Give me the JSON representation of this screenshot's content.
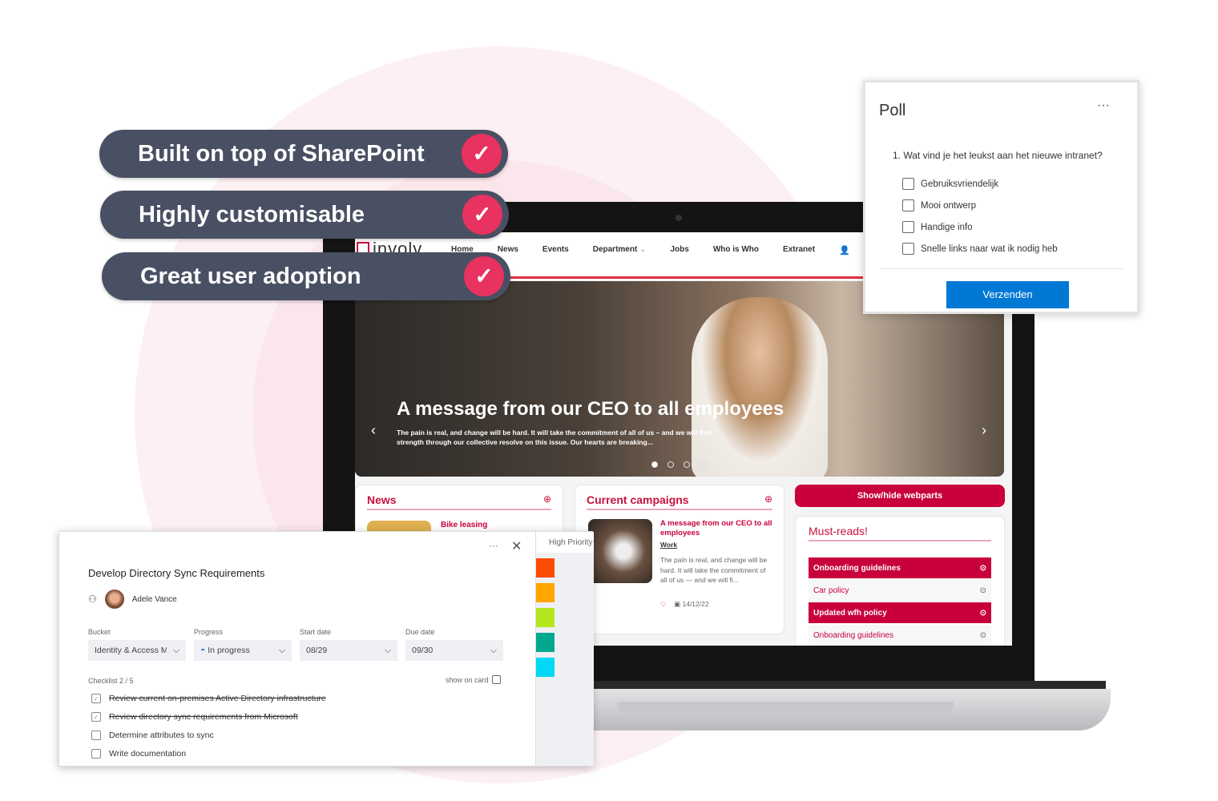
{
  "pills": [
    {
      "label": "Built on top of SharePoint"
    },
    {
      "label": "Highly customisable"
    },
    {
      "label": "Great user adoption"
    }
  ],
  "intranet": {
    "logo": "involv",
    "nav": [
      "Home",
      "News",
      "Events",
      "Department",
      "Jobs",
      "Who is Who",
      "Extranet"
    ],
    "hero": {
      "title": "A message from our CEO to all employees",
      "text": "The pain is real, and change will be hard. It will take the commitment of all of us – and we will find strength through our collective resolve on this issue.  Our hearts are breaking..."
    },
    "news": {
      "title": "News",
      "item": "Bike leasing"
    },
    "campaigns": {
      "title": "Current campaigns",
      "item_title": "A message from our CEO to all employees",
      "tag": "Work",
      "text": "The pain is real, and change will be hard. It will take the commitment of all of us — and we will fi...",
      "date": "14/12/22"
    },
    "show_hide": "Show/hide webparts",
    "must_reads": {
      "title": "Must-reads!",
      "items": [
        {
          "label": "Onboarding guidelines",
          "highlight": true
        },
        {
          "label": "Car policy",
          "highlight": false
        },
        {
          "label": "Updated wfh policy",
          "highlight": true
        },
        {
          "label": "Onboarding guidelines",
          "highlight": false
        }
      ]
    },
    "accent": "#c8003c"
  },
  "poll": {
    "title": "Poll",
    "question": "1. Wat vind je het leukst aan het nieuwe intranet?",
    "options": [
      "Gebruiksvriendelijk",
      "Mooi ontwerp",
      "Handige info",
      "Snelle links naar wat ik nodig heb"
    ],
    "submit": "Verzenden"
  },
  "planner": {
    "title": "Develop Directory Sync Requirements",
    "assignee": "Adele Vance",
    "priority_header": "High Priority",
    "fields": [
      {
        "label": "Bucket",
        "value": "Identity & Access M"
      },
      {
        "label": "Progress",
        "value": "In progress"
      },
      {
        "label": "Start date",
        "value": "08/29"
      },
      {
        "label": "Due date",
        "value": "09/30"
      }
    ],
    "checklist_label": "Checklist 2 / 5",
    "show_on_card": "show on card",
    "checklist": [
      {
        "text": "Review current on-premises Active Directory infrastructure",
        "done": true
      },
      {
        "text": "Review directory sync requirements from Microsoft",
        "done": true
      },
      {
        "text": "Determine attributes to sync",
        "done": false
      },
      {
        "text": "Write documentation",
        "done": false
      }
    ],
    "label_colors": [
      "#ff4b00",
      "#ffa500",
      "#b5e61d",
      "#00a88f",
      "#00d8f5"
    ]
  }
}
